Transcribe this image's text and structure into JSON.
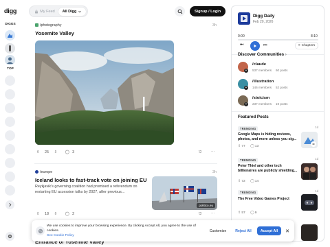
{
  "sidebar": {
    "logo": "digg",
    "diggs_label": "DIGGS",
    "top_label": "TOP",
    "expand_icon": "chevron-right-icon",
    "settings_icon": "gear-avatar-icon"
  },
  "header": {
    "feed_tabs": [
      "My Feed",
      "All Digg"
    ],
    "search_icon": "search-icon",
    "signup_label": "Signup / Login"
  },
  "posts": [
    {
      "community": "/photography",
      "age": "3h",
      "title": "Yosemite Valley",
      "likes": "25",
      "comments": "3"
    },
    {
      "community": "/europe",
      "age": "3h",
      "title": "Iceland looks to fast-track vote on joining EU",
      "excerpt": "Reykjavik’s governing coalition had promised a referendum on restarting EU accession talks by 2027, after previous...",
      "image_caption": "politico.eu",
      "likes": "18",
      "comments": "2"
    },
    {
      "title": "Entrance of Yosemite Valley"
    }
  ],
  "digg_daily": {
    "title": "Digg Daily",
    "date": "Feb 20, 2026",
    "time_current": "0:00",
    "time_total": "8:10",
    "chapters_label": "Chapters",
    "progress": 0
  },
  "discover": {
    "title": "Discover Communities",
    "communities": [
      {
        "name": "/claude",
        "members": "537 members",
        "posts": "60 posts",
        "color": "#c2654a"
      },
      {
        "name": "/illustration",
        "members": "146 members",
        "posts": "52 posts",
        "color": "#3a8fa3"
      },
      {
        "name": "/stoicism",
        "members": "237 members",
        "posts": "19 posts",
        "color": "#7a6a55"
      }
    ]
  },
  "featured": {
    "title": "Featured Posts",
    "posts": [
      {
        "tag": "TRENDING",
        "age": "1d",
        "title": "Google Maps is hiding reviews, photos, and more unless you sig...",
        "likes": "77",
        "comments": "13"
      },
      {
        "tag": "TRENDING",
        "age": "1d",
        "title": "Peter Thiel and other tech billionaires are publicly shielding...",
        "likes": "72",
        "comments": "14"
      },
      {
        "tag": "TRENDING",
        "age": "1d",
        "title": "The Free Video Games Project",
        "likes": "57",
        "comments": "9"
      },
      {
        "tag": "TRENDING",
        "age": "",
        "title": "",
        "likes": "",
        "comments": ""
      }
    ]
  },
  "cookie": {
    "text": "We use cookies to improve your browsing experience. By clicking Accept All, you agree to the use of cookies.",
    "policy_link": "See Cookie Policy",
    "customize_label": "Customize",
    "reject_label": "Reject All",
    "accept_label": "Accept All"
  },
  "colors": {
    "accent_blue": "#2f6fd6",
    "dark": "#111111",
    "chip_bg": "#eceef2"
  }
}
